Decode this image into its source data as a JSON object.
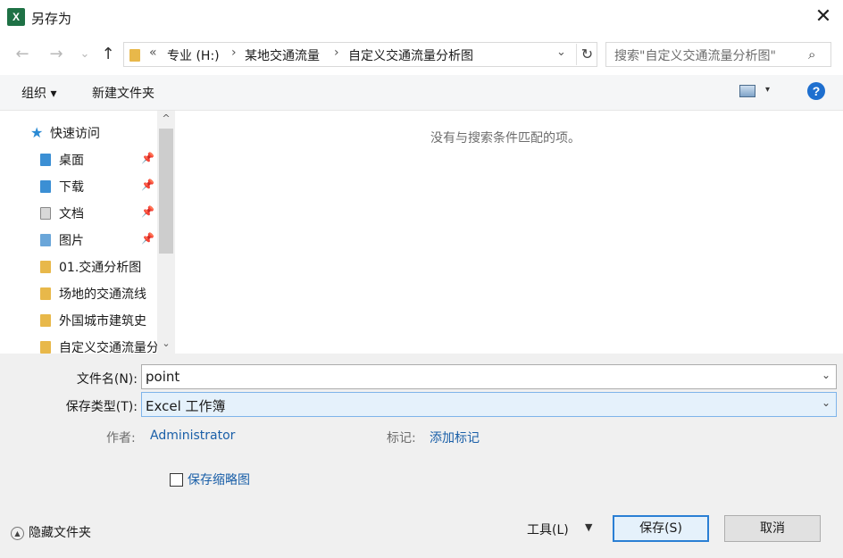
{
  "window": {
    "title": "另存为",
    "app_icon_letter": "X",
    "close_symbol": "✕"
  },
  "nav": {
    "back": "←",
    "forward": "→",
    "recent": "⌄",
    "up": "↑",
    "breadcrumb": [
      "专业 (H:)",
      "某地交通流量",
      "自定义交通流量分析图"
    ],
    "prefix": "«",
    "separator": "›",
    "dropdown": "⌄",
    "refresh": "↻"
  },
  "search": {
    "placeholder": "搜索\"自定义交通流量分析图\"",
    "icon": "⌕"
  },
  "toolbar": {
    "organize": "组织 ▾",
    "new_folder": "新建文件夹",
    "view_caret": "▾",
    "help": "?"
  },
  "sidebar": {
    "quick_access": "快速访问",
    "items": [
      {
        "label": "桌面",
        "pinned": true
      },
      {
        "label": "下载",
        "pinned": true
      },
      {
        "label": "文档",
        "pinned": true
      },
      {
        "label": "图片",
        "pinned": true
      },
      {
        "label": "01.交通分析图",
        "pinned": false
      },
      {
        "label": "场地的交通流线",
        "pinned": false
      },
      {
        "label": "外国城市建筑史",
        "pinned": false
      },
      {
        "label": "自定义交通流量分",
        "pinned": false
      }
    ],
    "pin_symbol": "📌",
    "scroll_up": "^",
    "scroll_down": "⌄"
  },
  "files": {
    "empty_message": "没有与搜索条件匹配的项。"
  },
  "form": {
    "filename_label": "文件名(N):",
    "filename_value": "point",
    "filetype_label": "保存类型(T):",
    "filetype_value": "Excel 工作簿",
    "dropdown": "⌄",
    "author_label": "作者:",
    "author_value": "Administrator",
    "tags_label": "标记:",
    "tags_value": "添加标记",
    "thumbnail_label": "保存缩略图",
    "thumbnail_checked": false
  },
  "footer": {
    "hide_folders": "隐藏文件夹",
    "hide_symbol": "▲",
    "tools": "工具(L)",
    "tools_caret": "▼",
    "save": "保存(S)",
    "cancel": "取消"
  }
}
